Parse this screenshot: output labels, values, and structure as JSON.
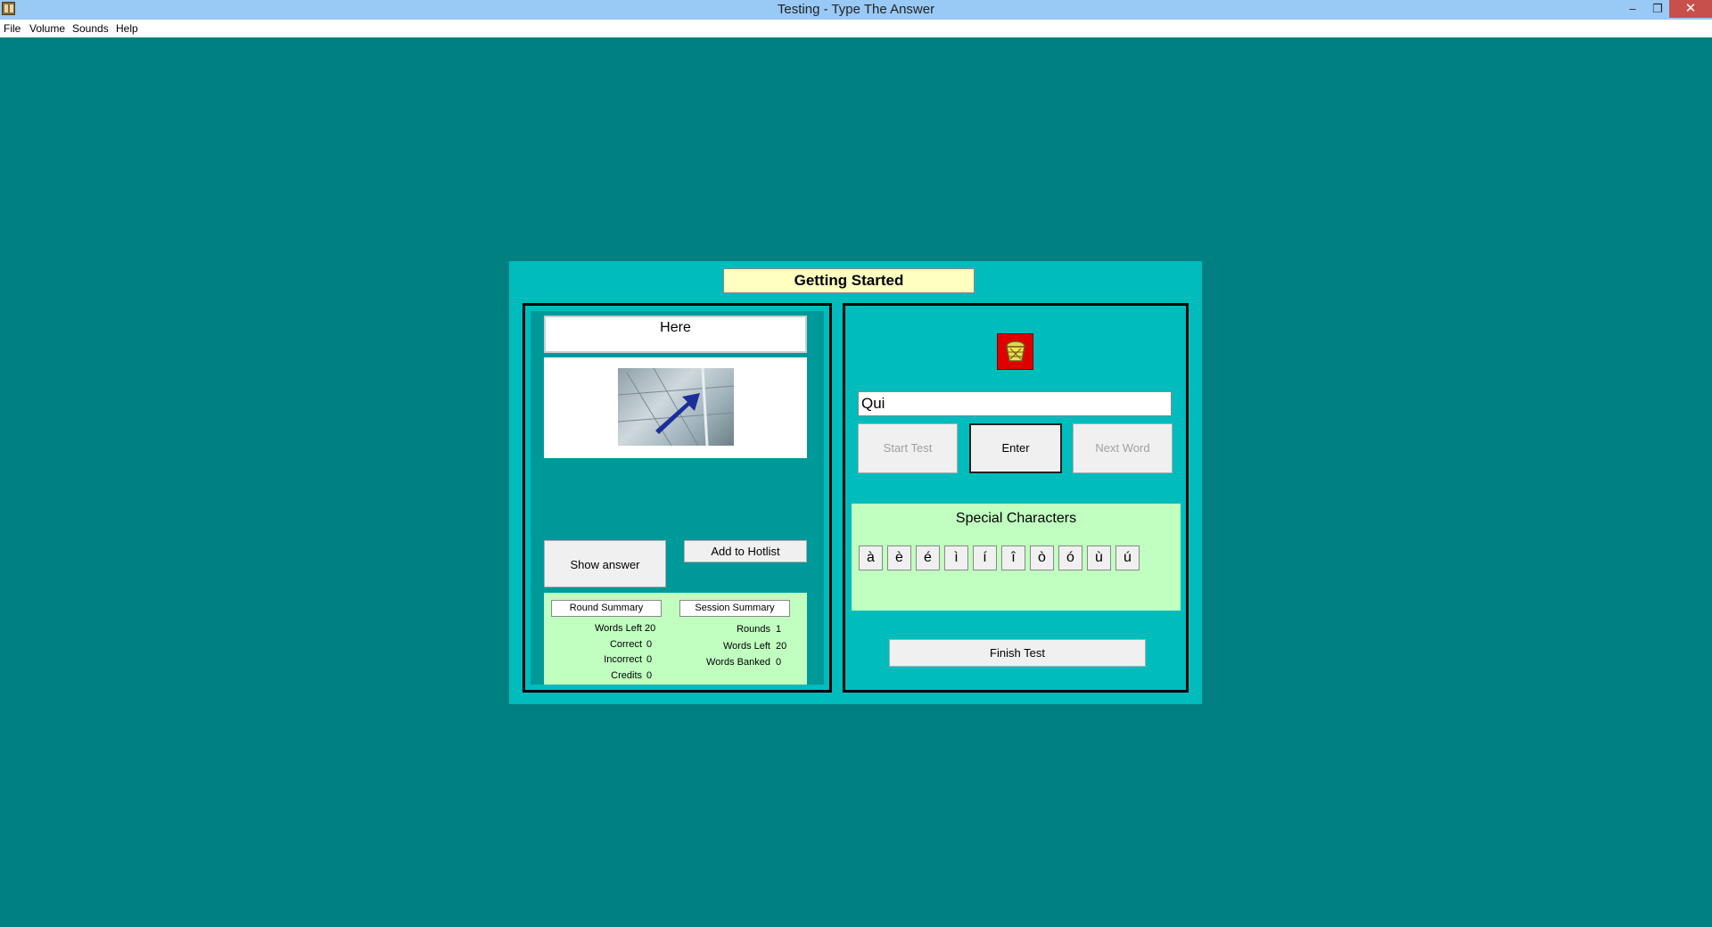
{
  "window": {
    "title": "Testing - Type The Answer",
    "minimize": "–",
    "restore": "❐",
    "close": "✕"
  },
  "menu": [
    "File",
    "Volume",
    "Sounds",
    "Help"
  ],
  "panel": {
    "heading": "Getting Started"
  },
  "question": {
    "prompt": "Here",
    "image_icon": "map-arrow-photo"
  },
  "buttons": {
    "show_answer": "Show answer",
    "add_hotlist": "Add to  Hotlist",
    "start_test": "Start Test",
    "enter": "Enter",
    "next_word": "Next Word",
    "finish_test": "Finish Test"
  },
  "round_summary": {
    "header": "Round Summary",
    "rows": [
      {
        "label": "Words Left",
        "value": "20"
      },
      {
        "label": "Correct",
        "value": "0"
      },
      {
        "label": "Incorrect",
        "value": "0"
      },
      {
        "label": "Credits",
        "value": "0"
      }
    ]
  },
  "session_summary": {
    "header": "Session Summary",
    "rows": [
      {
        "label": "Rounds",
        "value": "1"
      },
      {
        "label": "Words Left",
        "value": "20"
      },
      {
        "label": "Words Banked",
        "value": "0"
      }
    ]
  },
  "answer": {
    "value": "Qui"
  },
  "special_characters": {
    "title": "Special Characters",
    "chars": [
      "à",
      "è",
      "é",
      "ì",
      "í",
      "î",
      "ò",
      "ó",
      "ù",
      "ú"
    ]
  },
  "colors": {
    "background": "#008080",
    "panel": "#00bcbc",
    "summary": "#c0ffc0",
    "heading": "#ffffc0"
  }
}
